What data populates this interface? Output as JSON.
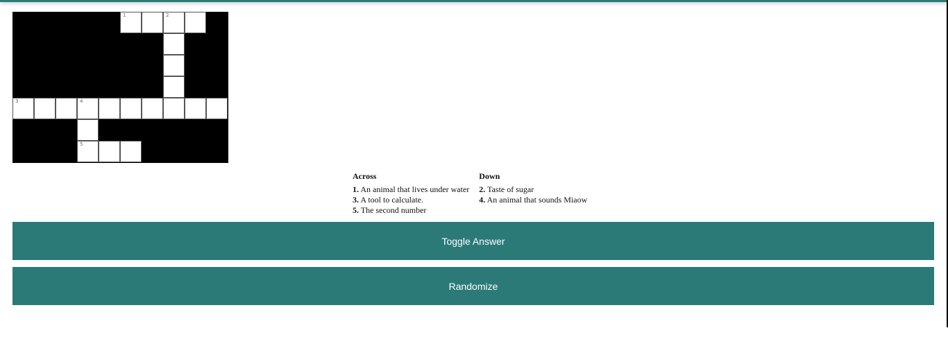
{
  "crossword": {
    "rows": 7,
    "cols": 10,
    "cells": [
      {
        "r": 0,
        "c": 5,
        "num": "1"
      },
      {
        "r": 0,
        "c": 6
      },
      {
        "r": 0,
        "c": 7,
        "num": "2"
      },
      {
        "r": 0,
        "c": 8
      },
      {
        "r": 1,
        "c": 7
      },
      {
        "r": 2,
        "c": 7
      },
      {
        "r": 3,
        "c": 7
      },
      {
        "r": 4,
        "c": 0,
        "num": "3"
      },
      {
        "r": 4,
        "c": 1
      },
      {
        "r": 4,
        "c": 2
      },
      {
        "r": 4,
        "c": 3,
        "num": "4"
      },
      {
        "r": 4,
        "c": 4
      },
      {
        "r": 4,
        "c": 5
      },
      {
        "r": 4,
        "c": 6
      },
      {
        "r": 4,
        "c": 7
      },
      {
        "r": 4,
        "c": 8
      },
      {
        "r": 4,
        "c": 9
      },
      {
        "r": 5,
        "c": 3
      },
      {
        "r": 6,
        "c": 3,
        "num": "5"
      },
      {
        "r": 6,
        "c": 4
      },
      {
        "r": 6,
        "c": 5
      }
    ]
  },
  "clues": {
    "across": {
      "title": "Across",
      "items": [
        {
          "num": "1.",
          "text": "An animal that lives under water"
        },
        {
          "num": "3.",
          "text": "A tool to calculate."
        },
        {
          "num": "5.",
          "text": "The second number"
        }
      ]
    },
    "down": {
      "title": "Down",
      "items": [
        {
          "num": "2.",
          "text": "Taste of sugar"
        },
        {
          "num": "4.",
          "text": "An animal that sounds Miaow"
        }
      ]
    }
  },
  "buttons": {
    "toggle_label": "Toggle Answer",
    "randomize_label": "Randomize"
  },
  "colors": {
    "accent": "#2b7a78",
    "grid_black": "#000000"
  }
}
